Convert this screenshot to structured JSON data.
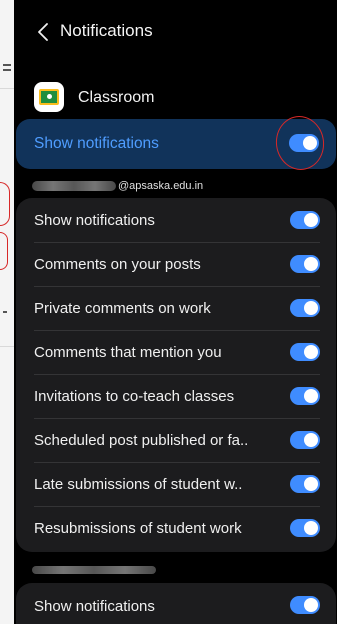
{
  "header": {
    "back_icon": "chevron-left-icon",
    "title": "Notifications"
  },
  "app": {
    "name": "Classroom",
    "icon": "google-classroom-icon"
  },
  "master_toggle": {
    "label": "Show notifications",
    "on": true
  },
  "accounts": [
    {
      "email_suffix": "@apsaska.edu.in",
      "settings": [
        {
          "label": "Show notifications",
          "on": true
        },
        {
          "label": "Comments on your posts",
          "on": true
        },
        {
          "label": "Private comments on work",
          "on": true
        },
        {
          "label": "Comments that mention you",
          "on": true
        },
        {
          "label": "Invitations to co-teach classes",
          "on": true
        },
        {
          "label": "Scheduled post published or fa..",
          "on": true
        },
        {
          "label": "Late submissions of student w..",
          "on": true
        },
        {
          "label": "Resubmissions of student work",
          "on": true
        }
      ]
    },
    {
      "email_suffix": "",
      "settings": [
        {
          "label": "Show notifications",
          "on": true
        }
      ]
    }
  ],
  "colors": {
    "accent": "#3f8cff",
    "highlight_bg": "#11335a",
    "highlight_text": "#4f9dff",
    "annotation": "#d72828"
  }
}
